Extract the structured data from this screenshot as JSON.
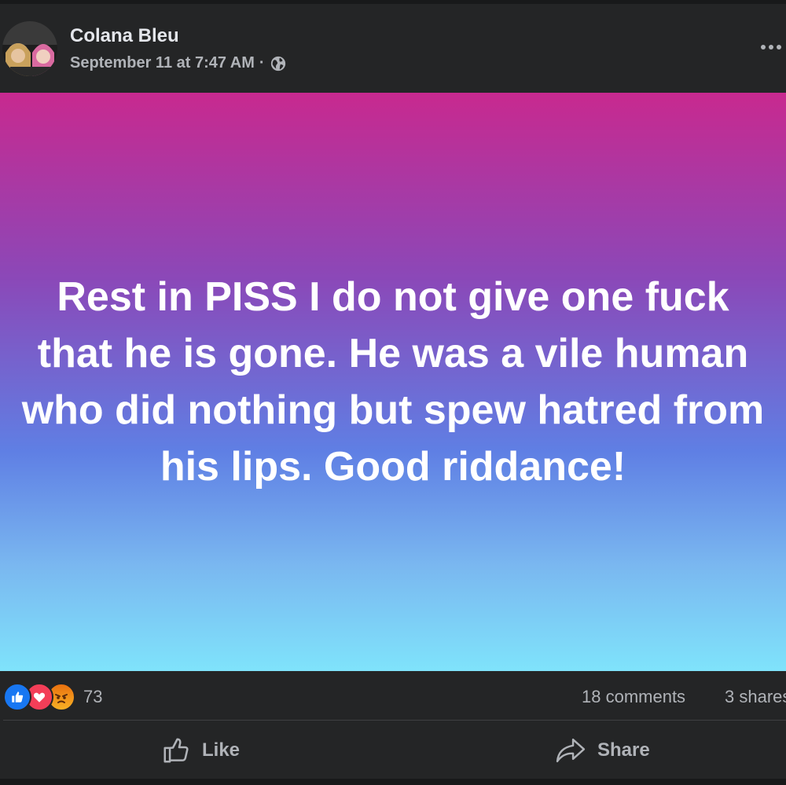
{
  "post": {
    "author": "Colana Bleu",
    "timestamp": "September 11 at 7:47 AM",
    "separator": "·",
    "privacy_icon": "globe-icon",
    "more_icon": "more-options-icon",
    "text": "Rest in PISS I do not give one fuck that he is gone. He was a vile human who did nothing but spew hatred from his lips. Good riddance!",
    "background_gradient": [
      "#c8298f",
      "#8b48b8",
      "#5f7fe4",
      "#7ab8f0",
      "#7fe3fb"
    ]
  },
  "stats": {
    "reactions": [
      "like",
      "love",
      "angry"
    ],
    "reaction_count": "73",
    "comments": "18 comments",
    "shares": "3 shares"
  },
  "actions": {
    "like_label": "Like",
    "share_label": "Share"
  },
  "colors": {
    "background": "#242526",
    "text_primary": "#e4e6eb",
    "text_secondary": "#b0b3b8",
    "like_blue": "#1877f2",
    "love_red": "#f33e58"
  }
}
